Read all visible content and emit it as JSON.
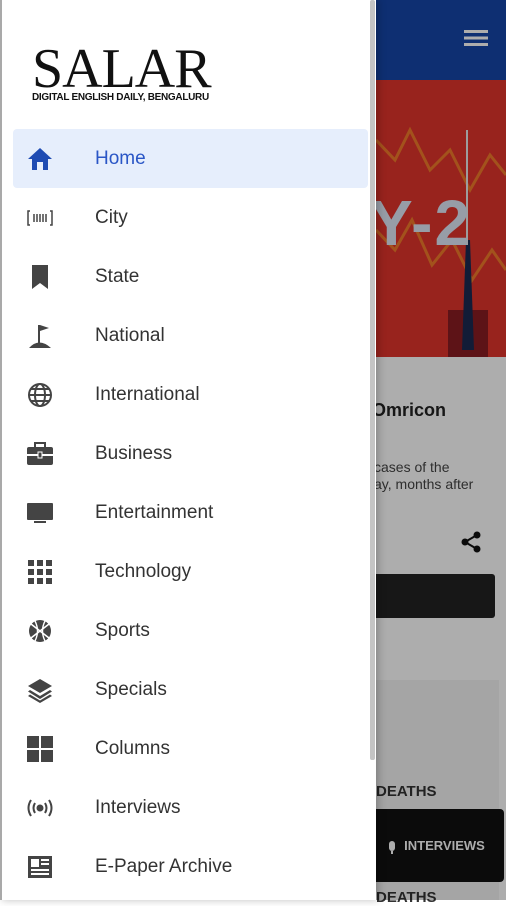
{
  "app": {
    "hero_text": "Y-2",
    "headline": "Omricon",
    "excerpt_lines": [
      "cases of the",
      "ay, months after"
    ],
    "deaths_label_1": "DEATHS",
    "deaths_label_2": "DEATHS",
    "interviews_button": "INTERVIEWS",
    "colors": {
      "topbar": "#1646a8",
      "hero": "#e0342c",
      "accent": "#2a56c6"
    }
  },
  "drawer": {
    "logo_title": "SALAR",
    "logo_subtitle": "DIGITAL ENGLISH DAILY, BENGALURU",
    "items": [
      {
        "label": "Home",
        "icon": "home-icon",
        "active": true
      },
      {
        "label": "City",
        "icon": "city-icon",
        "active": false
      },
      {
        "label": "State",
        "icon": "bookmark-icon",
        "active": false
      },
      {
        "label": "National",
        "icon": "flag-icon",
        "active": false
      },
      {
        "label": "International",
        "icon": "globe-icon",
        "active": false
      },
      {
        "label": "Business",
        "icon": "briefcase-icon",
        "active": false
      },
      {
        "label": "Entertainment",
        "icon": "tv-icon",
        "active": false
      },
      {
        "label": "Technology",
        "icon": "grid-icon",
        "active": false
      },
      {
        "label": "Sports",
        "icon": "basketball-icon",
        "active": false
      },
      {
        "label": "Specials",
        "icon": "layers-icon",
        "active": false
      },
      {
        "label": "Columns",
        "icon": "columns-icon",
        "active": false
      },
      {
        "label": "Interviews",
        "icon": "broadcast-icon",
        "active": false
      },
      {
        "label": "E-Paper Archive",
        "icon": "newspaper-icon",
        "active": false
      }
    ]
  }
}
